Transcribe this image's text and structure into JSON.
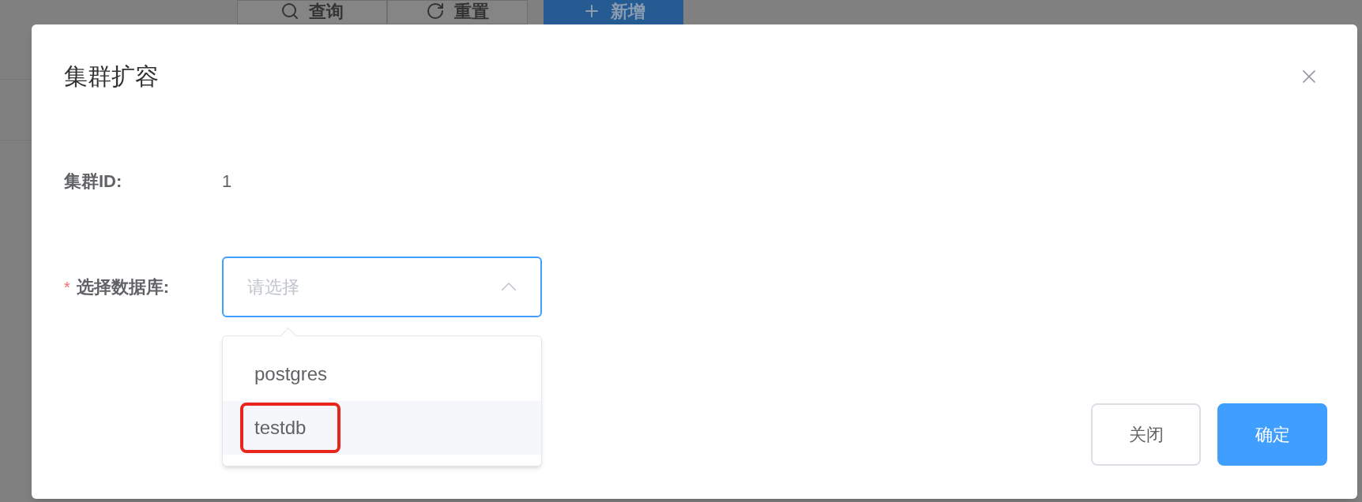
{
  "background_toolbar": {
    "buttons": [
      {
        "label": "查询",
        "kind": "search"
      },
      {
        "label": "重置",
        "kind": "reset"
      },
      {
        "label": "新增",
        "kind": "add"
      }
    ]
  },
  "dialog": {
    "title": "集群扩容",
    "fields": [
      {
        "kind": "text",
        "label": "集群ID:",
        "value": "1"
      },
      {
        "kind": "select",
        "required_mark": "*",
        "label": "选择数据库:",
        "placeholder": "请选择",
        "expanded": true,
        "options": [
          {
            "label": "postgres",
            "highlighted": false,
            "outlined": false
          },
          {
            "label": "testdb",
            "highlighted": true,
            "outlined": true
          }
        ]
      }
    ],
    "buttons": [
      {
        "label": "关闭",
        "kind": "default"
      },
      {
        "label": "确定",
        "kind": "primary"
      }
    ]
  }
}
